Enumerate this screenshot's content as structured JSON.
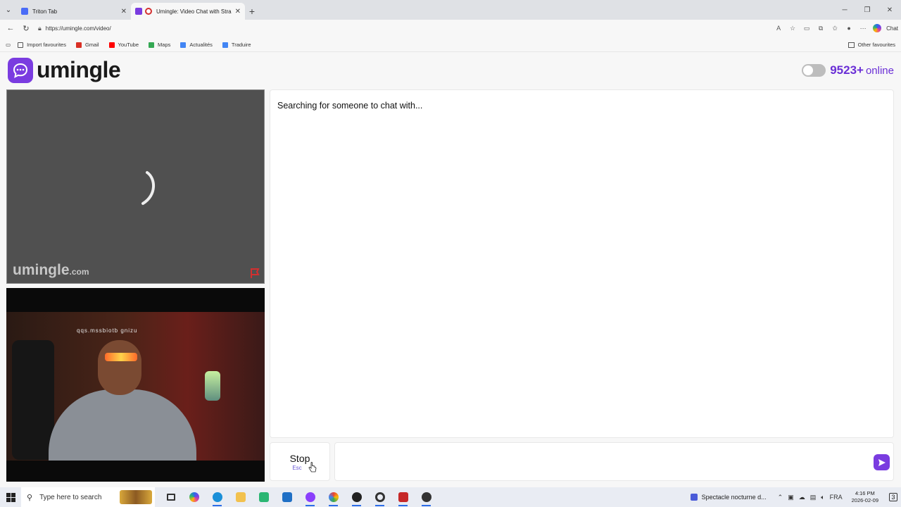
{
  "browser": {
    "tabs": [
      {
        "title": "Triton Tab",
        "active": false,
        "favicon_color": "#4a6cf7"
      },
      {
        "title": "Umingle: Video Chat with Stra",
        "active": true,
        "favicon_color": "#7a3ce0"
      }
    ],
    "url": "https://umingle.com/video/",
    "bookmarks": [
      {
        "label": "Import favourites",
        "icon": "import-icon",
        "color": "#555555"
      },
      {
        "label": "Gmail",
        "icon": "gmail-icon",
        "color": "#d93025"
      },
      {
        "label": "YouTube",
        "icon": "youtube-icon",
        "color": "#ff0000"
      },
      {
        "label": "Maps",
        "icon": "maps-icon",
        "color": "#34a853"
      },
      {
        "label": "Actualités",
        "icon": "news-icon",
        "color": "#4285f4"
      },
      {
        "label": "Traduire",
        "icon": "translate-icon",
        "color": "#4285f4"
      }
    ],
    "other_favourites": "Other favourites",
    "chat_label": "Chat"
  },
  "site": {
    "logo_text": "umingle",
    "online_count": "9523+",
    "online_label": "online",
    "accent_color": "#7a3ce0"
  },
  "video": {
    "watermark": "umingle",
    "watermark_suffix": ".com",
    "stream_overlay_text": "qqs.mssbiotb gnizu"
  },
  "chat": {
    "status": "Searching for someone to chat with...",
    "stop_label": "Stop",
    "stop_key": "Esc",
    "message_placeholder": ""
  },
  "taskbar": {
    "search_placeholder": "Type here to search",
    "media_title": "Spectacle nocturne d...",
    "language": "FRA",
    "time": "4:16 PM",
    "date": "2026-02-09",
    "notification_count": "3",
    "apps": [
      {
        "name": "task-view-icon",
        "color": "#333333"
      },
      {
        "name": "copilot-icon",
        "color": "#7b3fe4"
      },
      {
        "name": "edge-icon",
        "color": "#1a8fd8"
      },
      {
        "name": "file-explorer-icon",
        "color": "#f2c14e"
      },
      {
        "name": "store-icon",
        "color": "#2bb673"
      },
      {
        "name": "outlook-icon",
        "color": "#1f6fc5"
      },
      {
        "name": "messenger-icon",
        "color": "#8a3ffc"
      },
      {
        "name": "chrome-icon",
        "color": "#34a853"
      },
      {
        "name": "obs-icon",
        "color": "#222222"
      },
      {
        "name": "app-ring-icon",
        "color": "#333333"
      },
      {
        "name": "app-red-icon",
        "color": "#c62828"
      },
      {
        "name": "app-dark-icon",
        "color": "#333333"
      }
    ]
  }
}
